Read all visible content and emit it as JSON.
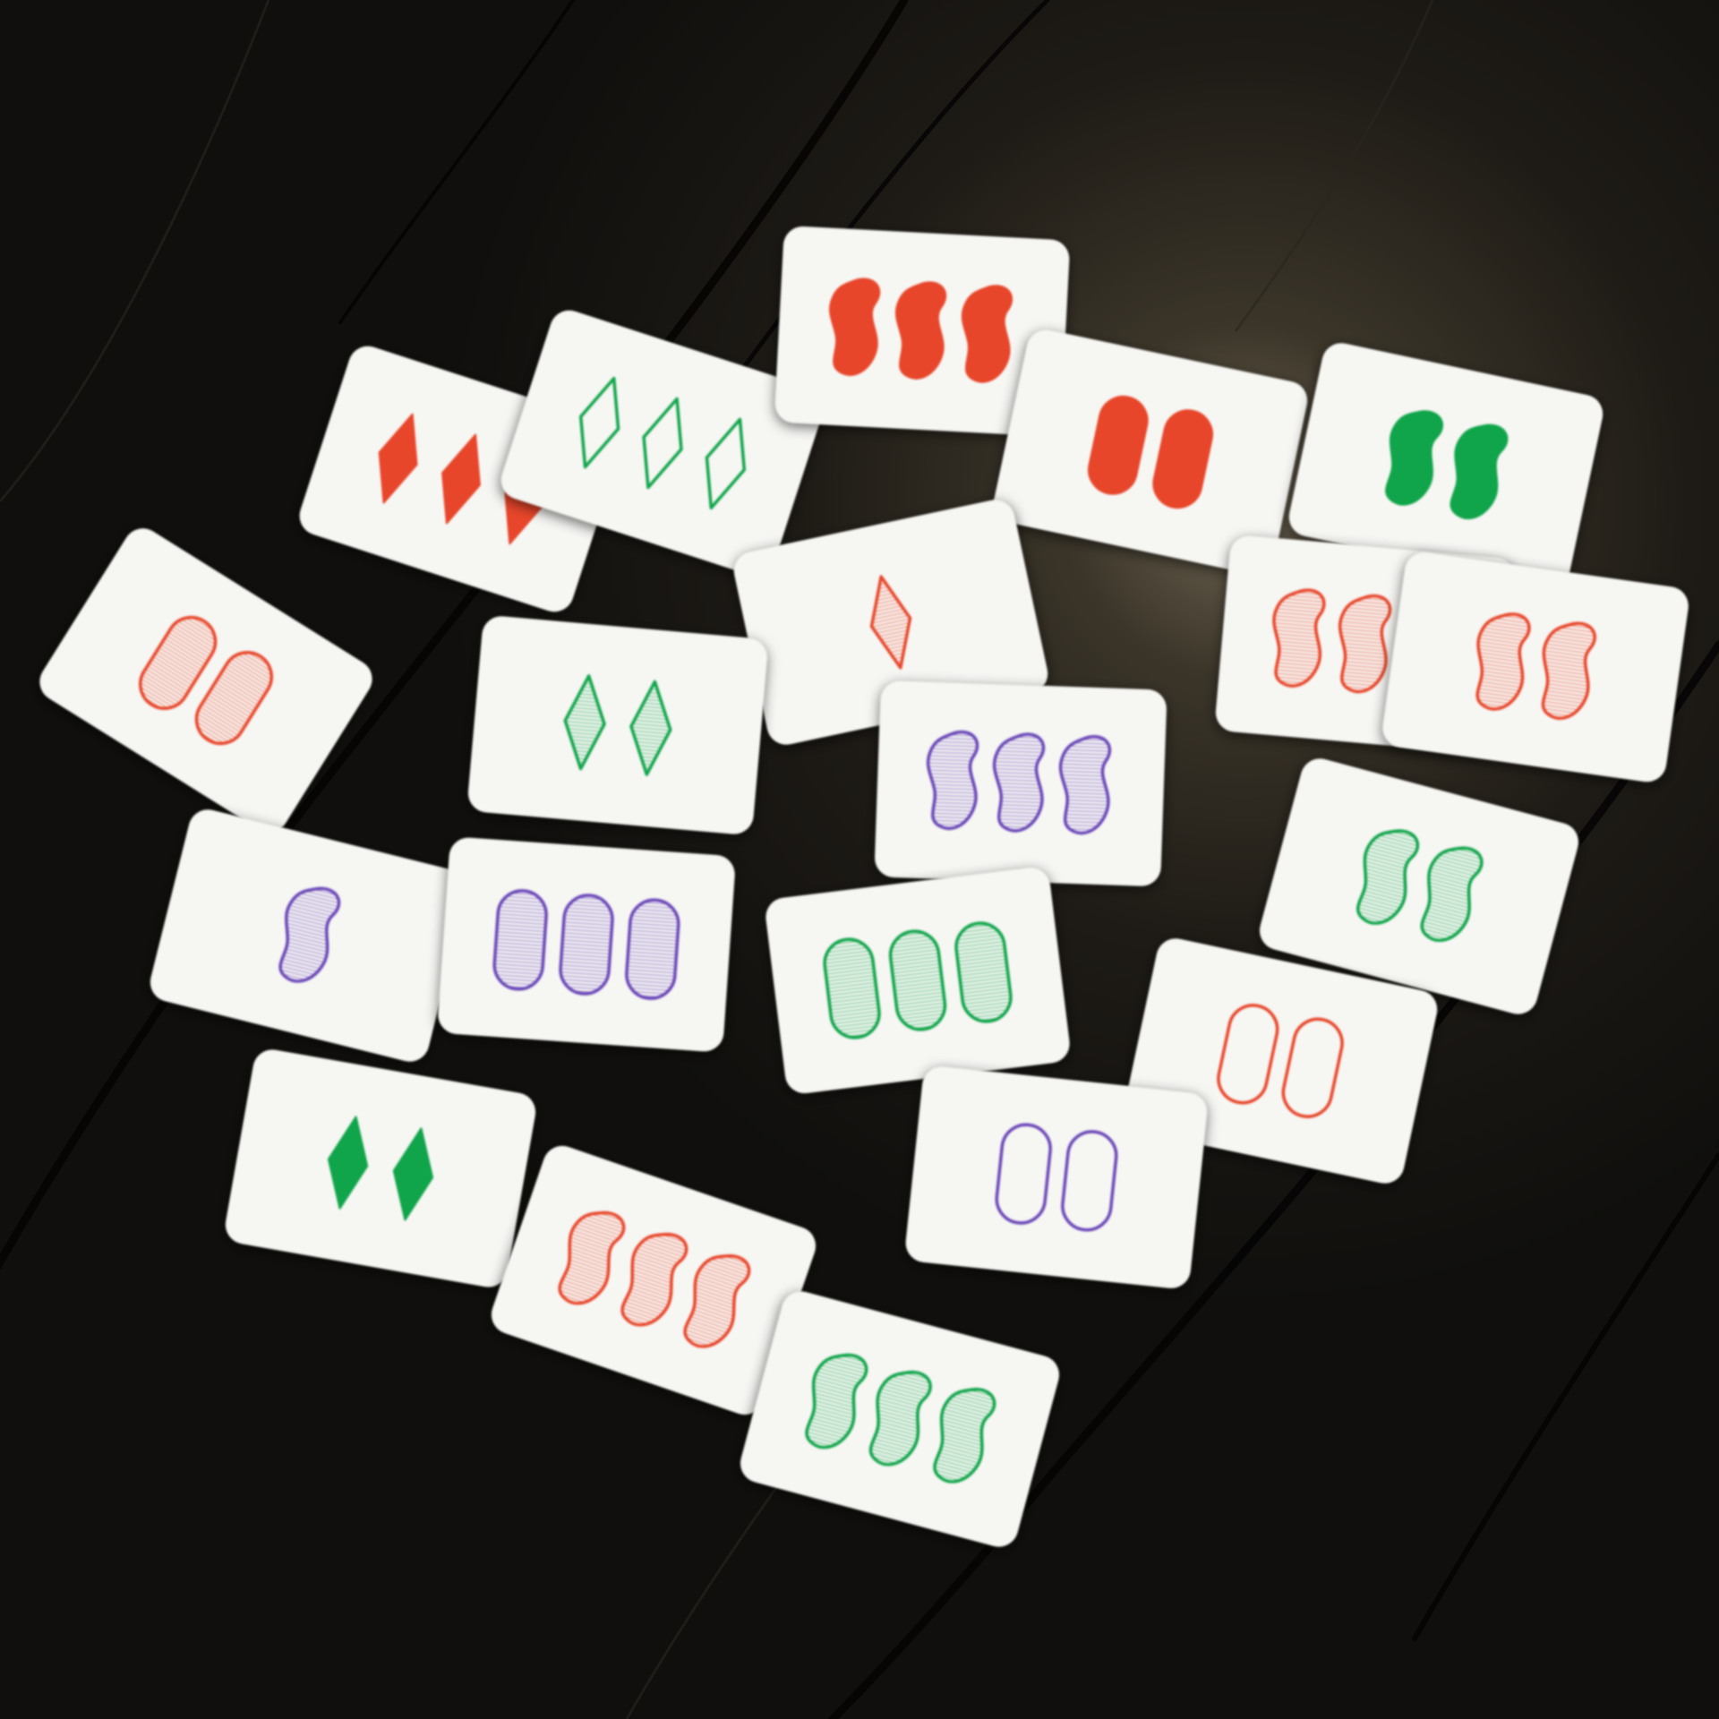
{
  "palette": {
    "red": "#e8462a",
    "green": "#10a54a",
    "purple": "#6a47b8",
    "table": "#141210",
    "card": "#f6f6f3"
  },
  "cards": [
    {
      "count": 3,
      "color": "red",
      "shape": "diamond",
      "shading": "solid"
    },
    {
      "count": 3,
      "color": "green",
      "shape": "diamond",
      "shading": "open"
    },
    {
      "count": 3,
      "color": "red",
      "shape": "squiggle",
      "shading": "solid"
    },
    {
      "count": 2,
      "color": "red",
      "shape": "oval",
      "shading": "solid"
    },
    {
      "count": 2,
      "color": "green",
      "shape": "squiggle",
      "shading": "solid"
    },
    {
      "count": 2,
      "color": "red",
      "shape": "oval",
      "shading": "striped"
    },
    {
      "count": 1,
      "color": "red",
      "shape": "diamond",
      "shading": "striped"
    },
    {
      "count": 2,
      "color": "green",
      "shape": "diamond",
      "shading": "striped"
    },
    {
      "count": 3,
      "color": "red",
      "shape": "squiggle",
      "shading": "striped"
    },
    {
      "count": 2,
      "color": "red",
      "shape": "squiggle",
      "shading": "striped"
    },
    {
      "count": 3,
      "color": "purple",
      "shape": "squiggle",
      "shading": "striped"
    },
    {
      "count": 1,
      "color": "purple",
      "shape": "squiggle",
      "shading": "striped"
    },
    {
      "count": 3,
      "color": "purple",
      "shape": "oval",
      "shading": "striped"
    },
    {
      "count": 3,
      "color": "green",
      "shape": "oval",
      "shading": "striped"
    },
    {
      "count": 2,
      "color": "green",
      "shape": "squiggle",
      "shading": "striped"
    },
    {
      "count": 2,
      "color": "red",
      "shape": "oval",
      "shading": "open"
    },
    {
      "count": 2,
      "color": "purple",
      "shape": "oval",
      "shading": "open"
    },
    {
      "count": 2,
      "color": "green",
      "shape": "diamond",
      "shading": "solid"
    },
    {
      "count": 3,
      "color": "red",
      "shape": "squiggle",
      "shading": "striped"
    },
    {
      "count": 3,
      "color": "green",
      "shape": "squiggle",
      "shading": "striped"
    }
  ]
}
